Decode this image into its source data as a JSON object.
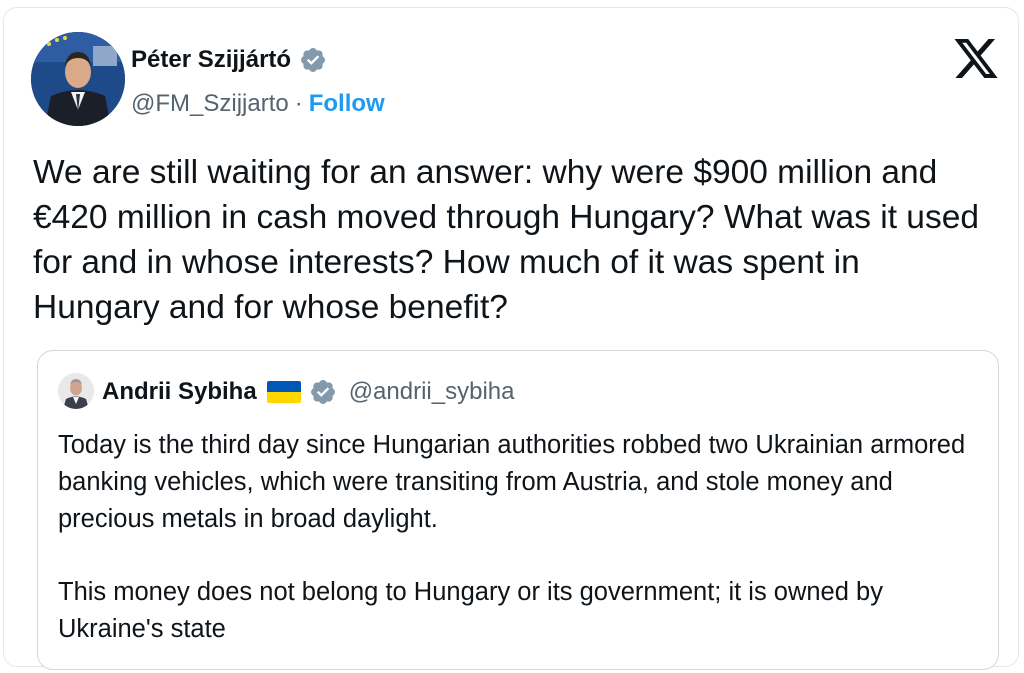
{
  "tweet": {
    "author": {
      "name": "Péter Szijjártó",
      "handle": "@FM_Szijjarto",
      "separator": "·",
      "follow_label": "Follow",
      "verified_color": "#829aab"
    },
    "logo": "x-logo-icon",
    "text": "We are still waiting for an answer: why were $900 million and €420 million in cash moved through Hungary? What was it used for and in whose interests? How much of it was spent in Hungary and for whose benefit?"
  },
  "quote": {
    "author": {
      "name": "Andrii Sybiha",
      "handle": "@andrii_sybiha",
      "flag": "ukraine-flag-icon",
      "verified_color": "#829aab"
    },
    "paragraphs": [
      "Today is the third day since Hungarian authorities robbed two Ukrainian armored banking vehicles, which were transiting from Austria, and stole money and precious metals in broad daylight.",
      "This money does not belong to Hungary or its government; it is owned by Ukraine's state"
    ]
  },
  "colors": {
    "follow": "#1d9bf0",
    "secondary_text": "#536471",
    "flag_blue": "#0057b7",
    "flag_yellow": "#ffd700"
  }
}
